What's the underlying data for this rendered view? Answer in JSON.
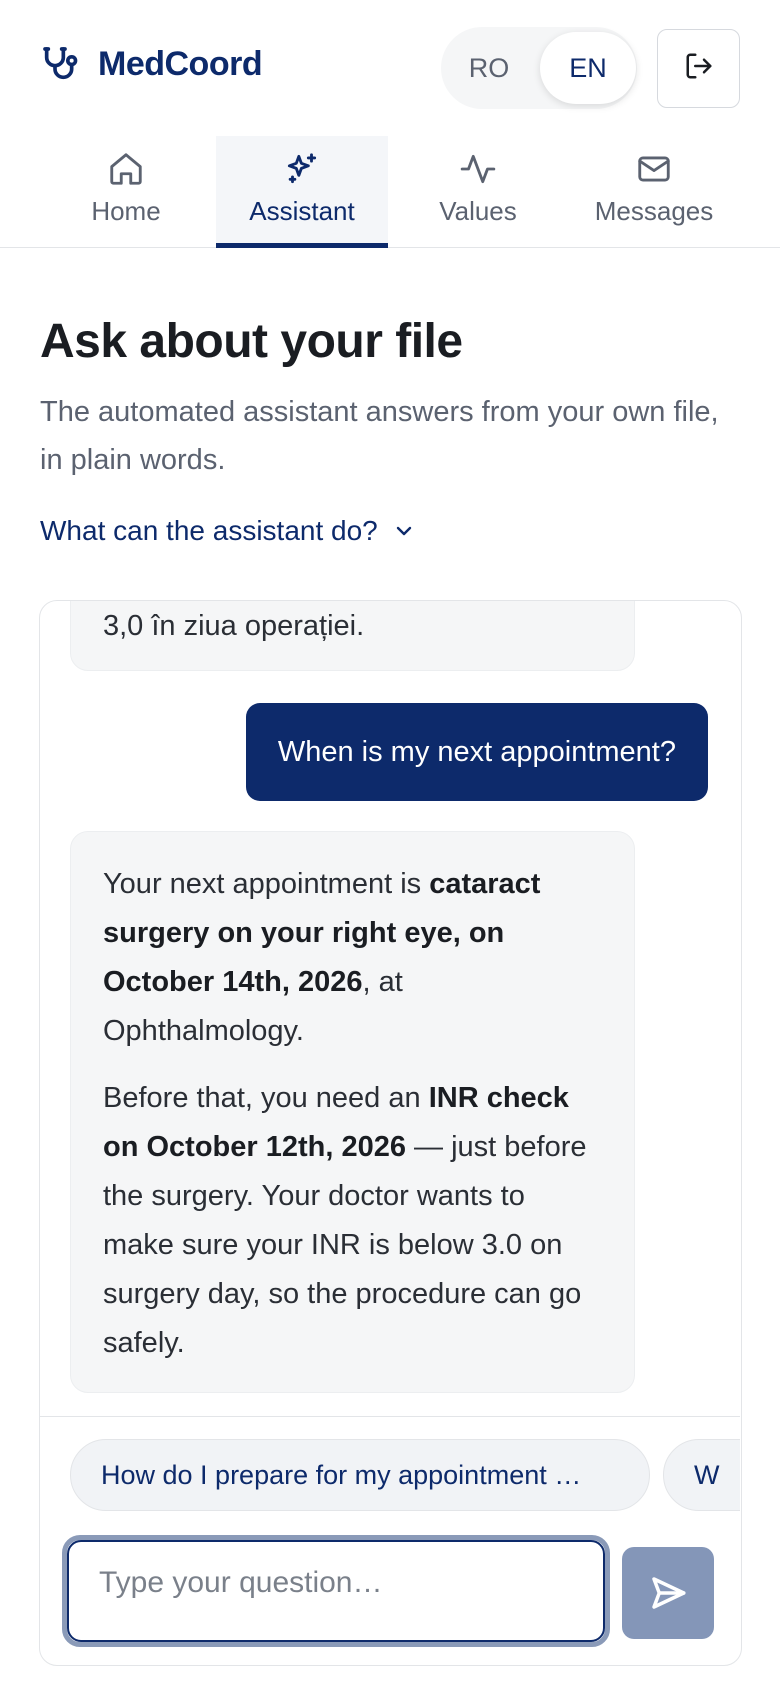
{
  "brand": {
    "name": "MedCoord",
    "icon": "stethoscope-icon"
  },
  "language": {
    "options": [
      "RO",
      "EN"
    ],
    "selected": "EN"
  },
  "logout": {
    "icon": "logout-icon"
  },
  "tabs": [
    {
      "label": "Home",
      "icon": "home-icon"
    },
    {
      "label": "Assistant",
      "icon": "sparkles-icon",
      "active": true
    },
    {
      "label": "Values",
      "icon": "activity-icon"
    },
    {
      "label": "Messages",
      "icon": "mail-icon"
    }
  ],
  "page": {
    "title": "Ask about your file",
    "subtitle": "The automated assistant answers from your own file, in plain words.",
    "help_toggle": "What can the assistant do?"
  },
  "chat": {
    "previous_bot_tail": "3,0 în ziua operației.",
    "user_message": "When is my next appointment?",
    "answer": {
      "p1_a": "Your next appointment is ",
      "p1_b": "cataract surgery on your right eye, on October 14th, 2026",
      "p1_c": ", at Ophthalmology.",
      "p2_a": "Before that, you need an ",
      "p2_b": "INR check on October 12th, 2026",
      "p2_c": " — just before the surgery. Your doctor wants to make sure your INR is below 3.0 on surgery day, so the procedure can go safely."
    },
    "suggestions": [
      "How do I prepare for my appointment …",
      "W"
    ],
    "input": {
      "value": "",
      "placeholder": "Type your question…"
    },
    "send_icon": "send-icon"
  },
  "colors": {
    "primary": "#0d2a6b",
    "bubble_bg": "#f5f6f7",
    "send_disabled": "#8496b8",
    "muted_text": "#5b6270"
  }
}
